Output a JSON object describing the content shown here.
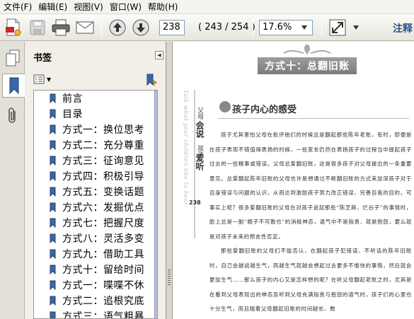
{
  "menubar": {
    "items": [
      "文件(F)",
      "编辑(E)",
      "视图(V)",
      "窗口(W)",
      "帮助(H)"
    ]
  },
  "toolbar": {
    "current_page": "238",
    "page_total": "( 243 / 254 )",
    "zoom": "17.6%",
    "brand_fragment": "注释"
  },
  "nav_panel": {
    "title": "书签",
    "bookmarks": [
      "前言",
      "目录",
      "方式一：换位思考",
      "方式二：充分尊重",
      "方式三：征询意见",
      "方式四：积极引导",
      "方式五：变换话题",
      "方式六：发掘优点",
      "方式七：把握尺度",
      "方式八：灵活多变",
      "方式九：借助工具",
      "方式十：留给时间",
      "方式一：喋喋不休",
      "方式二：追根究底",
      "方式三：语气粗暴"
    ]
  },
  "document": {
    "chapter_title": "方式十：总翻旧账",
    "side_title_line1": "父母",
    "side_title_line2": "会说",
    "side_title_line3": "孩子",
    "side_title_line4": "爱听",
    "side_english": "Talk what your children like to hear",
    "page_number": "238",
    "section_title": "孩子内心的感受",
    "paragraphs": [
      "孩子尤其害怕父母在批评他们的时候总是翻起那些陈年老账，有时，即便是在孩子表现不错值得表扬的时候，一些家长仍然在表扬孩子的过程当中提起孩子过去的一些糗事或错误。父母总爱翻旧账，这是很多孩子对父母提出的一条重要意见。总爱翻起陈年旧账的父母也许是想通过不断翻旧账的方式来加深孩子对于自身错误与问题的认识，从而达到激励孩子努力改正错误、完善自我的目的。可事实上呢？很多爱翻旧账的父母在对孩子说起那些“陈芝麻、烂谷子”的事情时，脸上总是一副“瘾子不可教也”的消极神态，语气中不是指责、就是抱怨，要么就是对孩子未来的预言性否定。",
      "那些爱翻旧账的父母们不能否认，在翻起孩子犯错误、不听话的陈年旧账时，自己会越说越生气，而越生气就越会想起过去更多不愉快的事情，然后就会更加生气……那么孩子的内心又是怎样想的呢？在听父母翻起老账之时，尤其是在看到父母表现出的神态及听到父母充满指责与抱怨的语气时，孩子们的心里也十分生气，而且随着父母翻起旧账的时间越长、数"
    ]
  }
}
